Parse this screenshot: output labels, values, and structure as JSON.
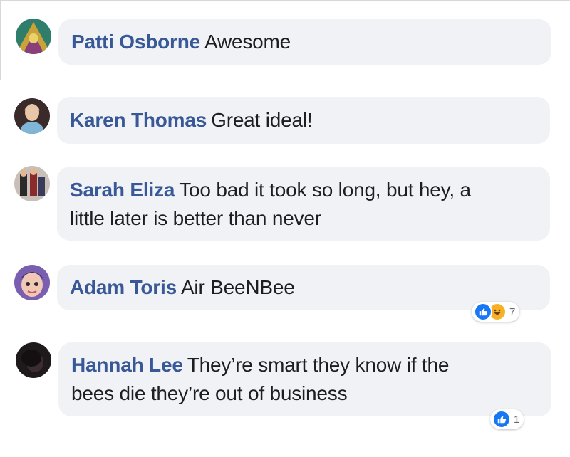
{
  "comments": [
    {
      "author": "Patti Osborne",
      "text": "Awesome",
      "reactions": null
    },
    {
      "author": "Karen Thomas",
      "text": "Great ideal!",
      "reactions": null
    },
    {
      "author": "Sarah Eliza",
      "text_line1": "Too bad it took so long, but hey, a",
      "text_line2": "little later is better than never",
      "reactions": null
    },
    {
      "author": "Adam Toris",
      "text": "Air BeeNBee",
      "reactions": {
        "icons": [
          "like-icon",
          "haha-icon"
        ],
        "count": "7"
      }
    },
    {
      "author": "Hannah Lee",
      "text_line1": "They’re smart they know if the",
      "text_line2": "bees die they’re out of business",
      "reactions": {
        "icons": [
          "like-icon"
        ],
        "count": "1"
      }
    }
  ],
  "colors": {
    "author": "#385898",
    "bubble": "#f0f2f5",
    "text": "#1c1e21",
    "like": "#1877f2",
    "haha": "#f7b125"
  }
}
